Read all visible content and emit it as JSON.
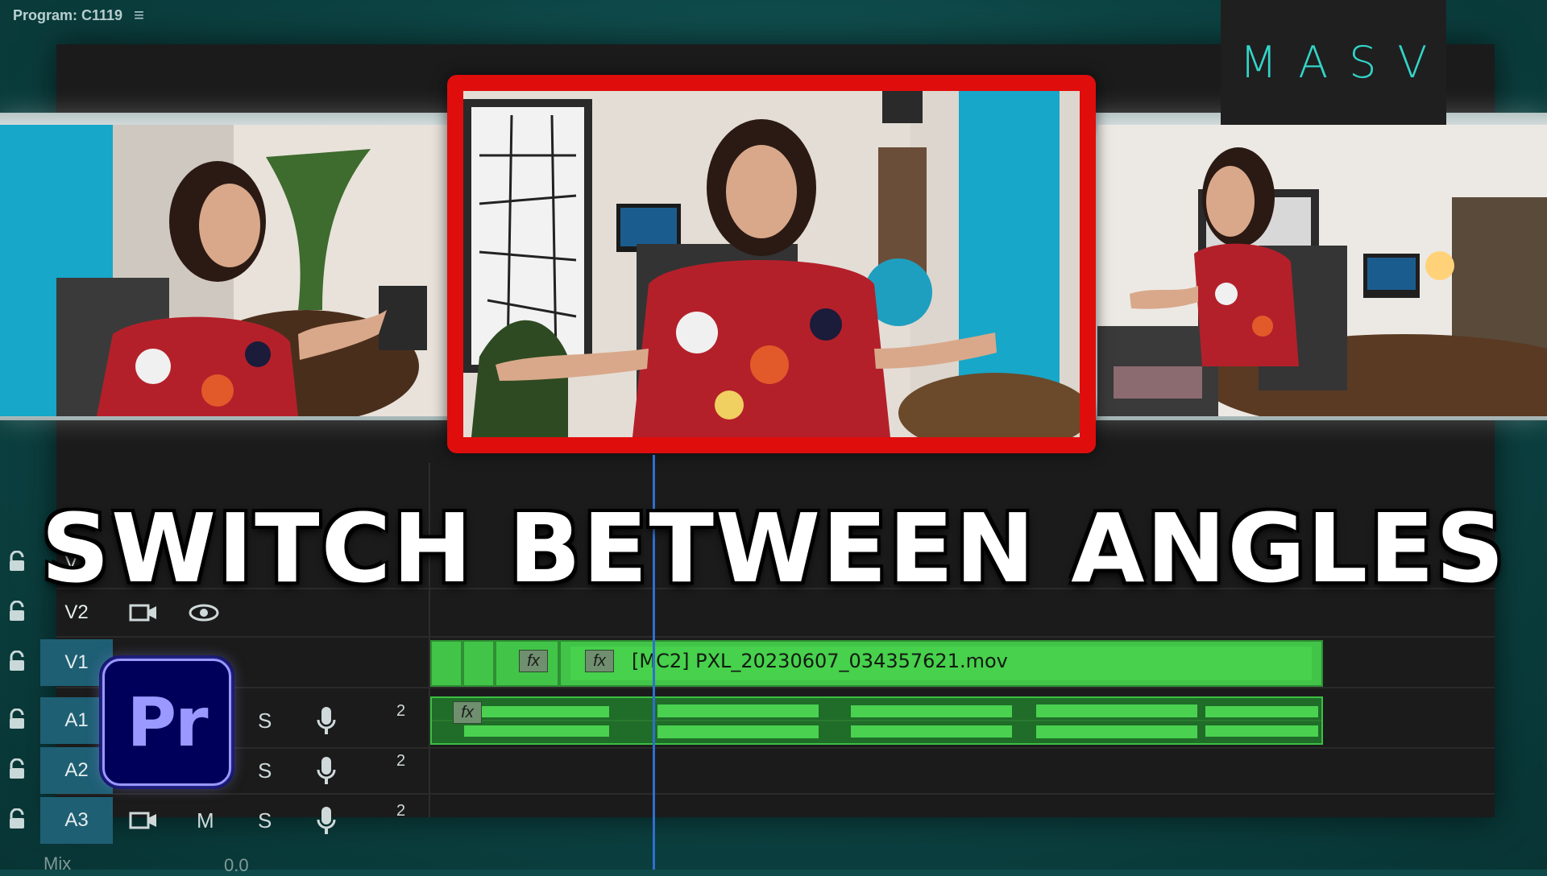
{
  "header": {
    "program_label": "Program: C1119",
    "menu_icon": "hamburger-icon"
  },
  "logo": {
    "text": "MASV",
    "color": "#33d4c8"
  },
  "headline": "SWITCH BETWEEN ANGLES",
  "colors": {
    "active_frame": "#e00d0d",
    "clip_green": "#42c449",
    "playhead": "#2e6fd0",
    "track_active": "#1f5f74",
    "premiere_purple": "#9999ff",
    "premiere_bg": "#00005b"
  },
  "timeline": {
    "tracks": [
      {
        "name": "V3",
        "icons": []
      },
      {
        "name": "V2",
        "icons": [
          "film-icon",
          "eye-icon"
        ]
      },
      {
        "name": "V1",
        "icons": [],
        "active": true
      },
      {
        "name": "A1",
        "s": "S",
        "icons": [
          "microphone-icon"
        ],
        "num": "2"
      },
      {
        "name": "A2",
        "s": "S",
        "icons": [
          "microphone-icon"
        ],
        "num": "2"
      },
      {
        "name": "A3",
        "m": "M",
        "s": "S",
        "icons": [
          "film-icon",
          "microphone-icon"
        ],
        "num": "2"
      }
    ],
    "video_clip": {
      "label": "[MC2] PXL_20230607_034357621.mov",
      "fx": "fx"
    },
    "audio_clip": {
      "fx": "fx"
    },
    "mix": {
      "label": "Mix",
      "value": "0.0"
    }
  },
  "premiere_logo": {
    "text": "Pr"
  }
}
